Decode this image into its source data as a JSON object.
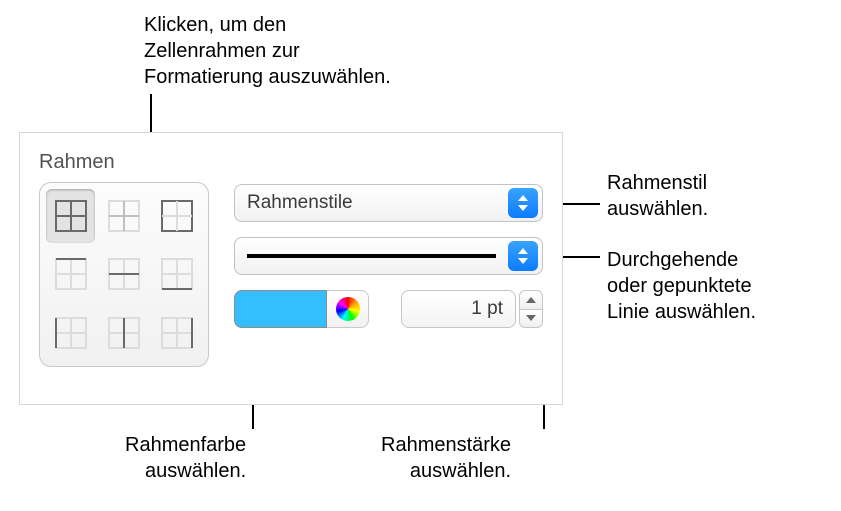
{
  "callouts": {
    "grid": "Klicken, um den\nZellenrahmen zur\nFormatierung auszuwählen.",
    "style": "Rahmenstil\nauswählen.",
    "lineType": "Durchgehende\noder gepunktete\nLinie auswählen.",
    "color": "Rahmenfarbe\nauswählen.",
    "width": "Rahmenstärke\nauswählen."
  },
  "panel": {
    "section": "Rahmen",
    "styleDropdown": "Rahmenstile",
    "width": "1 pt",
    "color": "#35beff"
  }
}
